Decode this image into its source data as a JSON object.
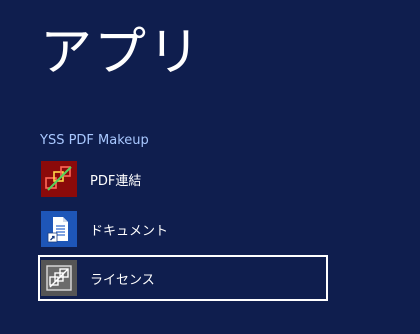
{
  "page": {
    "title": "アプリ"
  },
  "group": {
    "name": "YSS PDF Makeup",
    "header_color": "#a9c8ff"
  },
  "apps": [
    {
      "label": "PDF連結",
      "icon": "pdf-merge-icon",
      "tile_color": "#8b0a0a",
      "selected": false
    },
    {
      "label": "ドキュメント",
      "icon": "document-shortcut-icon",
      "tile_color": "#1e56b8",
      "selected": false
    },
    {
      "label": "ライセンス",
      "icon": "license-icon",
      "tile_color": "#555555",
      "selected": true
    }
  ],
  "colors": {
    "background": "#0f1e4e",
    "text": "#ffffff",
    "selection_border": "#ffffff"
  }
}
